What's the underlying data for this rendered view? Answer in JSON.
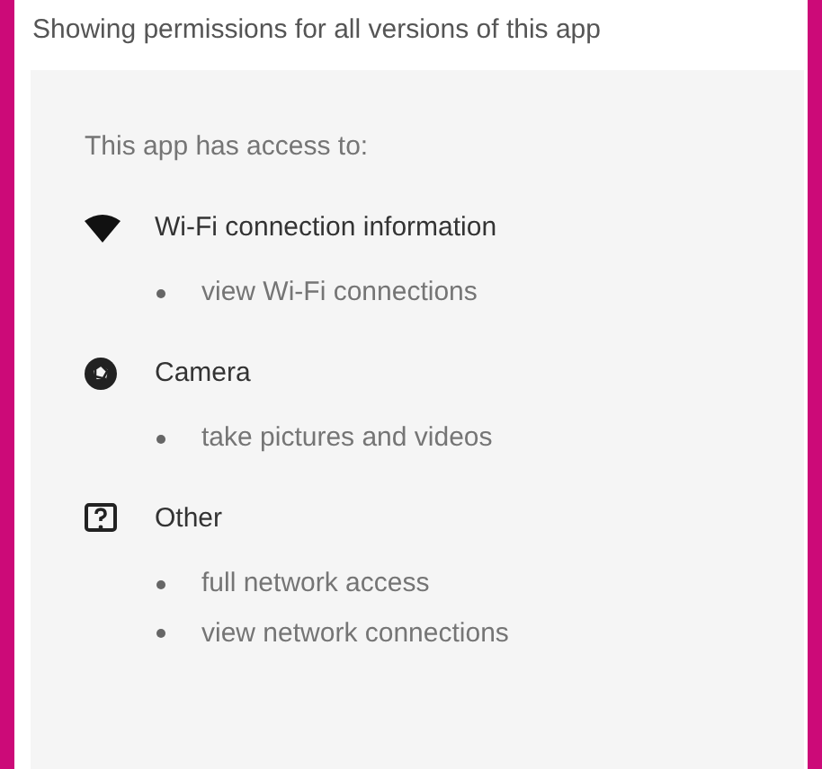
{
  "header": "Showing permissions for all versions of this app",
  "intro": "This app has access to:",
  "groups": [
    {
      "kind": "wifi",
      "title": "Wi-Fi connection information",
      "items": [
        "view Wi-Fi connections"
      ]
    },
    {
      "kind": "camera",
      "title": "Camera",
      "items": [
        "take pictures and videos"
      ]
    },
    {
      "kind": "other",
      "title": "Other",
      "items": [
        "full network access",
        "view network connections"
      ]
    }
  ]
}
